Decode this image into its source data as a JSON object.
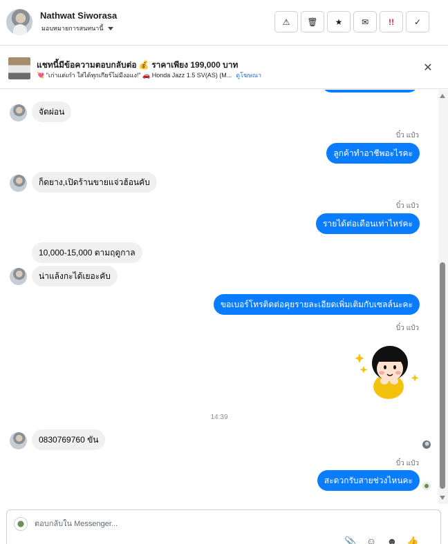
{
  "header": {
    "contact_name": "Nathwat Siworasa",
    "assign_label": "มอบหมายการสนทนานี้",
    "actions": [
      {
        "name": "mark-spam-button",
        "glyph": "⚠"
      },
      {
        "name": "delete-button",
        "glyph": "🗑"
      },
      {
        "name": "star-button",
        "glyph": "★"
      },
      {
        "name": "mark-unread-button",
        "glyph": "✉"
      },
      {
        "name": "important-button",
        "glyph": "!!"
      },
      {
        "name": "mark-done-button",
        "glyph": "✓"
      }
    ]
  },
  "ad": {
    "title": "แชทนี้มีข้อความตอบกลับต่อ 💰 ราคาเพียง 199,000 บาท",
    "subtitle": "💘 \"เก่าแต่เก๋า ใส่ได้ทุกเกียร์ไม่มีงอแง!\" 🚗 Honda Jazz 1.5 SV(AS) (M...",
    "link": "ดูโฆษณา",
    "close_glyph": "✕"
  },
  "messages": {
    "in_1": "จัดผ่อน",
    "out_sender_1": "บิ๋ว แป๋ว",
    "out_1": "ลูกค้าทำอาชีพอะไรคะ",
    "in_2": "ก็ดยาง,เปิดร้านขายแจ่วฮ้อนคับ",
    "out_sender_2": "บิ๋ว แป๋ว",
    "out_2": "รายได้ต่อเดือนเท่าไหร่คะ",
    "in_3": "10,000-15,000 ตามฤดูกาล",
    "in_4": "น่าแล้งกะได้เยอะคับ",
    "out_3": "ขอเบอร์โทรติดต่อคุยรายละเอียดเพิ่มเติมกับเซลล์นะคะ",
    "out_sender_3": "บิ๋ว แป๋ว",
    "timestamp": "14:39",
    "in_5": "0830769760 ขัน",
    "out_sender_4": "บิ๋ว แป๋ว",
    "out_4": "สะดวกรับสายช่วงไหนคะ"
  },
  "composer": {
    "placeholder": "ตอบกลับใน Messenger...",
    "tools": [
      "📎",
      "☺",
      "☻",
      "👍"
    ]
  },
  "colors": {
    "outgoing_bubble": "#0a7cff",
    "incoming_bubble": "#f0f0f0",
    "link": "#216fdb"
  }
}
